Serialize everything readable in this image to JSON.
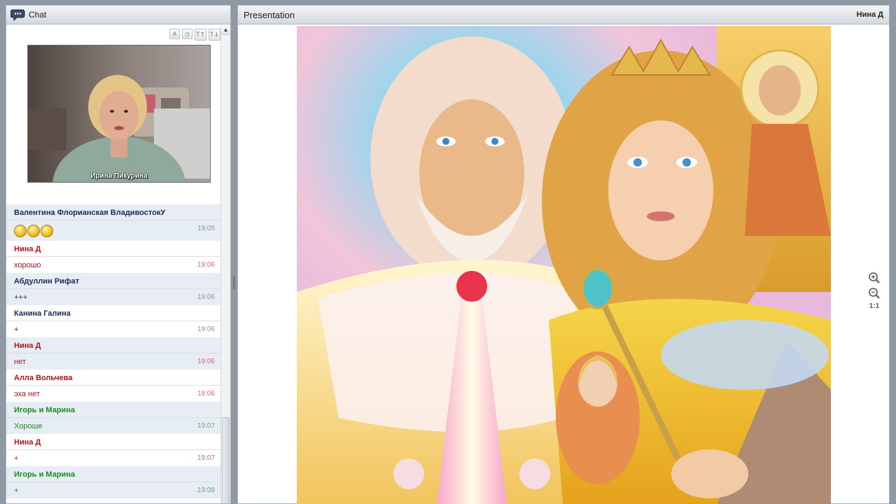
{
  "chat": {
    "title": "Chat",
    "toolbar": [
      "A",
      "◷",
      "T↑",
      "T↓"
    ],
    "webcam_user": "Ирина Пикурина",
    "messages": [
      {
        "author": "Валентина Флорианская ВладивостокУ",
        "text": "",
        "emoji_count": 3,
        "time": "19:05",
        "color": "navy",
        "shade": true
      },
      {
        "author": "Нина Д",
        "text": "хорошо",
        "time": "19:06",
        "color": "red",
        "shade": false
      },
      {
        "author": "Абдуллин Рифат",
        "text": "+++",
        "time": "19:06",
        "color": "navy",
        "shade": true
      },
      {
        "author": "Канина  Галина",
        "text": "+",
        "time": "19:06",
        "color": "navy",
        "shade": false
      },
      {
        "author": "Нина Д",
        "text": "нет",
        "time": "19:06",
        "color": "red",
        "shade": true
      },
      {
        "author": "Алла Вольчева",
        "text": "эха нет",
        "time": "19:06",
        "color": "red",
        "shade": false
      },
      {
        "author": "Игорь и Марина",
        "text": "Хороше",
        "time": "19:07",
        "color": "green",
        "shade": true
      },
      {
        "author": "Нина Д",
        "text": "+",
        "time": "19:07",
        "color": "red",
        "shade": false
      },
      {
        "author": "Игорь и Марина",
        "text": "+",
        "time": "19:08",
        "color": "green",
        "shade": true
      }
    ]
  },
  "presentation": {
    "title": "Presentation",
    "user": "Нина Д",
    "zoom_ratio": "1:1"
  },
  "icons": {
    "chat": "chat-bubble-icon",
    "zoom_in": "zoom-in-icon",
    "zoom_out": "zoom-out-icon"
  },
  "colors": {
    "navy": "#1c2a55",
    "red": "#b81414",
    "green": "#1e8c1e"
  }
}
